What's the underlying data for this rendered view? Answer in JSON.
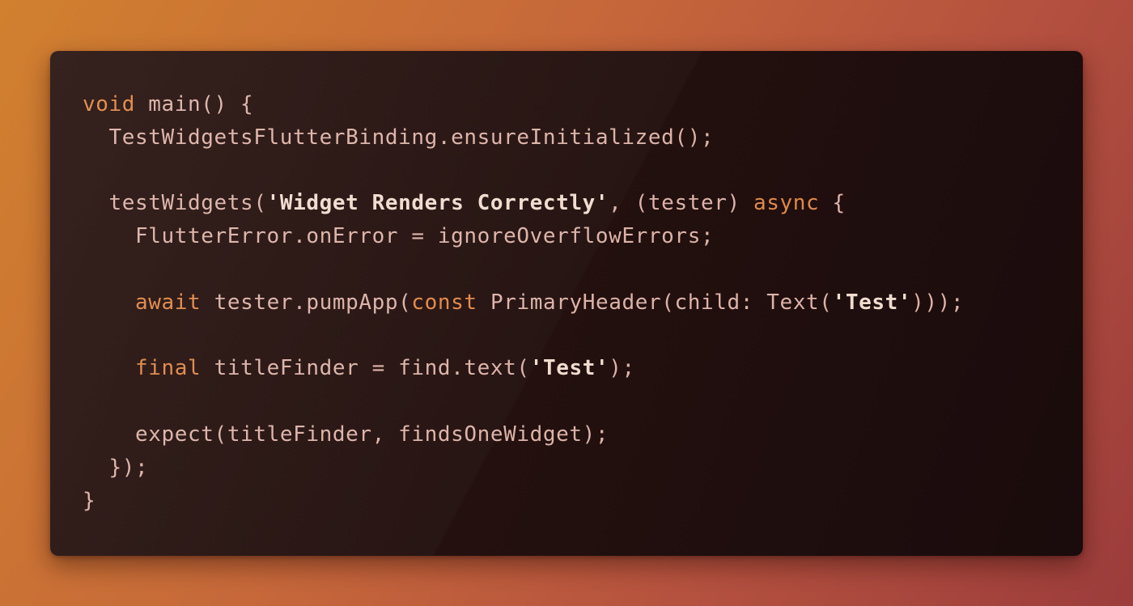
{
  "code": {
    "lines": [
      [
        {
          "t": "kw",
          "v": "void"
        },
        {
          "t": "pun",
          "v": " "
        },
        {
          "t": "fn",
          "v": "main"
        },
        {
          "t": "pun",
          "v": "() {"
        }
      ],
      [
        {
          "t": "pun",
          "v": "  "
        },
        {
          "t": "id",
          "v": "TestWidgetsFlutterBinding"
        },
        {
          "t": "pun",
          "v": "."
        },
        {
          "t": "fn",
          "v": "ensureInitialized"
        },
        {
          "t": "pun",
          "v": "();"
        }
      ],
      [],
      [
        {
          "t": "pun",
          "v": "  "
        },
        {
          "t": "fn",
          "v": "testWidgets"
        },
        {
          "t": "pun",
          "v": "("
        },
        {
          "t": "str",
          "v": "'Widget Renders Correctly'"
        },
        {
          "t": "pun",
          "v": ", (tester) "
        },
        {
          "t": "kw",
          "v": "async"
        },
        {
          "t": "pun",
          "v": " {"
        }
      ],
      [
        {
          "t": "pun",
          "v": "    "
        },
        {
          "t": "id",
          "v": "FlutterError"
        },
        {
          "t": "pun",
          "v": "."
        },
        {
          "t": "id",
          "v": "onError"
        },
        {
          "t": "pun",
          "v": " = "
        },
        {
          "t": "id",
          "v": "ignoreOverflowErrors"
        },
        {
          "t": "pun",
          "v": ";"
        }
      ],
      [],
      [
        {
          "t": "pun",
          "v": "    "
        },
        {
          "t": "kw",
          "v": "await"
        },
        {
          "t": "pun",
          "v": " "
        },
        {
          "t": "id",
          "v": "tester"
        },
        {
          "t": "pun",
          "v": "."
        },
        {
          "t": "fn",
          "v": "pumpApp"
        },
        {
          "t": "pun",
          "v": "("
        },
        {
          "t": "kw",
          "v": "const"
        },
        {
          "t": "pun",
          "v": " "
        },
        {
          "t": "id",
          "v": "PrimaryHeader"
        },
        {
          "t": "pun",
          "v": "(child: "
        },
        {
          "t": "id",
          "v": "Text"
        },
        {
          "t": "pun",
          "v": "("
        },
        {
          "t": "str",
          "v": "'Test'"
        },
        {
          "t": "pun",
          "v": ")));"
        }
      ],
      [],
      [
        {
          "t": "pun",
          "v": "    "
        },
        {
          "t": "kw",
          "v": "final"
        },
        {
          "t": "pun",
          "v": " "
        },
        {
          "t": "id",
          "v": "titleFinder"
        },
        {
          "t": "pun",
          "v": " = "
        },
        {
          "t": "id",
          "v": "find"
        },
        {
          "t": "pun",
          "v": "."
        },
        {
          "t": "fn",
          "v": "text"
        },
        {
          "t": "pun",
          "v": "("
        },
        {
          "t": "str",
          "v": "'Test'"
        },
        {
          "t": "pun",
          "v": ");"
        }
      ],
      [],
      [
        {
          "t": "pun",
          "v": "    "
        },
        {
          "t": "fn",
          "v": "expect"
        },
        {
          "t": "pun",
          "v": "("
        },
        {
          "t": "id",
          "v": "titleFinder"
        },
        {
          "t": "pun",
          "v": ", "
        },
        {
          "t": "id",
          "v": "findsOneWidget"
        },
        {
          "t": "pun",
          "v": ");"
        }
      ],
      [
        {
          "t": "pun",
          "v": "  });"
        }
      ],
      [
        {
          "t": "pun",
          "v": "}"
        }
      ]
    ]
  },
  "colors": {
    "keyword": "#e0894a",
    "text": "#dcb3a8",
    "string": "#f1dccf",
    "editor_background": "#24110f",
    "page_background": "#c6683a"
  }
}
